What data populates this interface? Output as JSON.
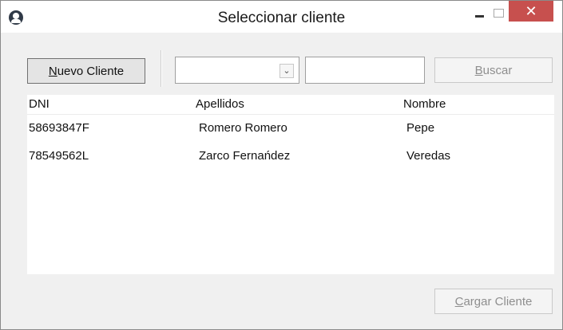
{
  "window": {
    "title": "Seleccionar cliente",
    "close_glyph": "✕",
    "icons": {
      "app": "user-icon",
      "minimize": "minimize-icon",
      "maximize": "maximize-icon",
      "close": "close-icon"
    }
  },
  "toolbar": {
    "new_client_accel": "N",
    "new_client_rest": "uevo Cliente",
    "search_field_value": "",
    "search_combo_value": "",
    "search_accel": "B",
    "search_rest": "uscar",
    "combo_arrow_glyph": "⌄"
  },
  "table": {
    "columns": [
      "DNI",
      "Apellidos",
      "Nombre"
    ],
    "rows": [
      {
        "dni": "58693847F",
        "apellidos": "Romero Romero",
        "nombre": "Pepe"
      },
      {
        "dni": "78549562L",
        "apellidos": "Zarco Fernańdez",
        "nombre": "Veredas"
      }
    ]
  },
  "footer": {
    "load_accel": "C",
    "load_rest": "argar Cliente"
  },
  "colors": {
    "close_button": "#c7504e",
    "window_bg": "#f0f0f0"
  }
}
